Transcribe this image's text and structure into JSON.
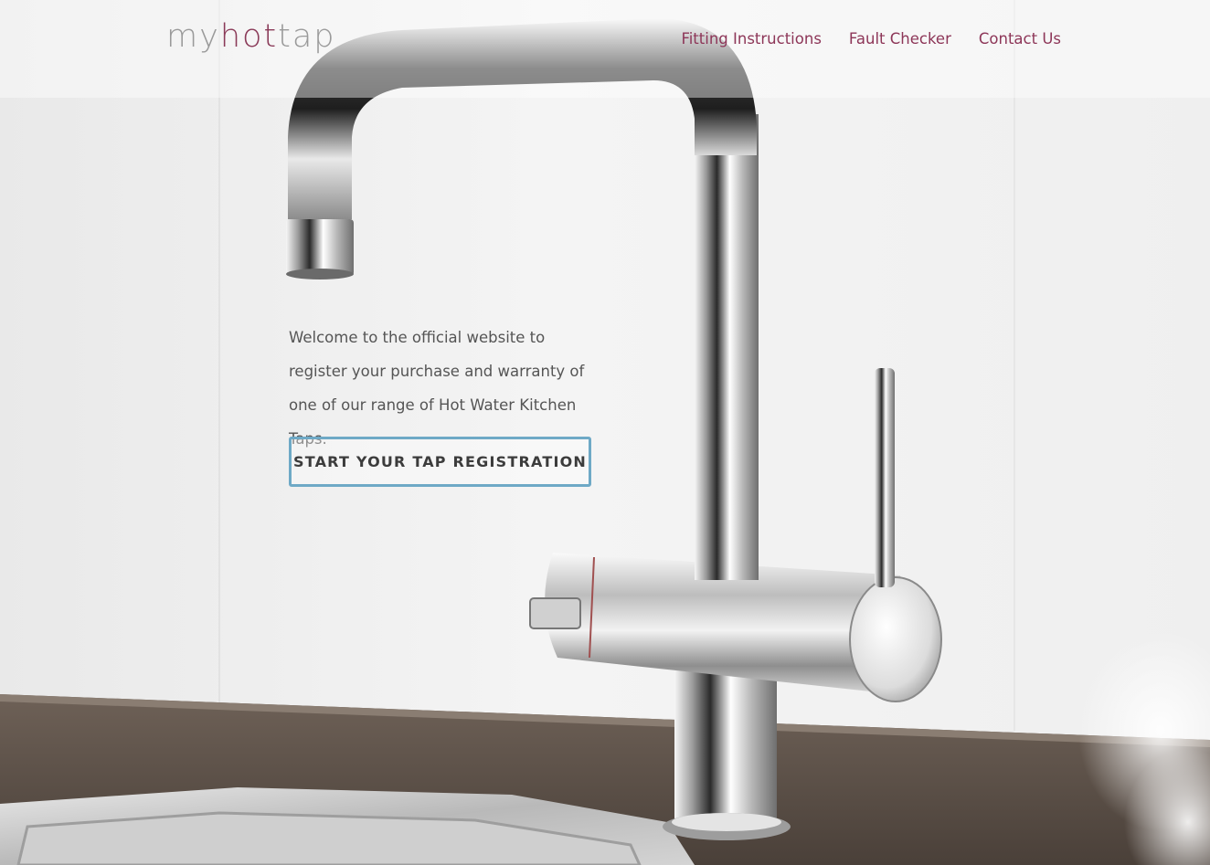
{
  "header": {
    "logo": {
      "part1": "my",
      "part2": "hot",
      "part3": "tap"
    },
    "nav": [
      {
        "label": "Fitting Instructions"
      },
      {
        "label": "Fault Checker"
      },
      {
        "label": "Contact Us"
      }
    ]
  },
  "hero": {
    "intro_text": "Welcome to the official website to register your purchase and warranty of one of our range of Hot Water Kitchen Taps.",
    "cta_label": "START YOUR TAP REGISTRATION"
  },
  "colors": {
    "brand_accent": "#8d3658",
    "button_border": "#6ea9c6",
    "body_text": "#555555"
  }
}
